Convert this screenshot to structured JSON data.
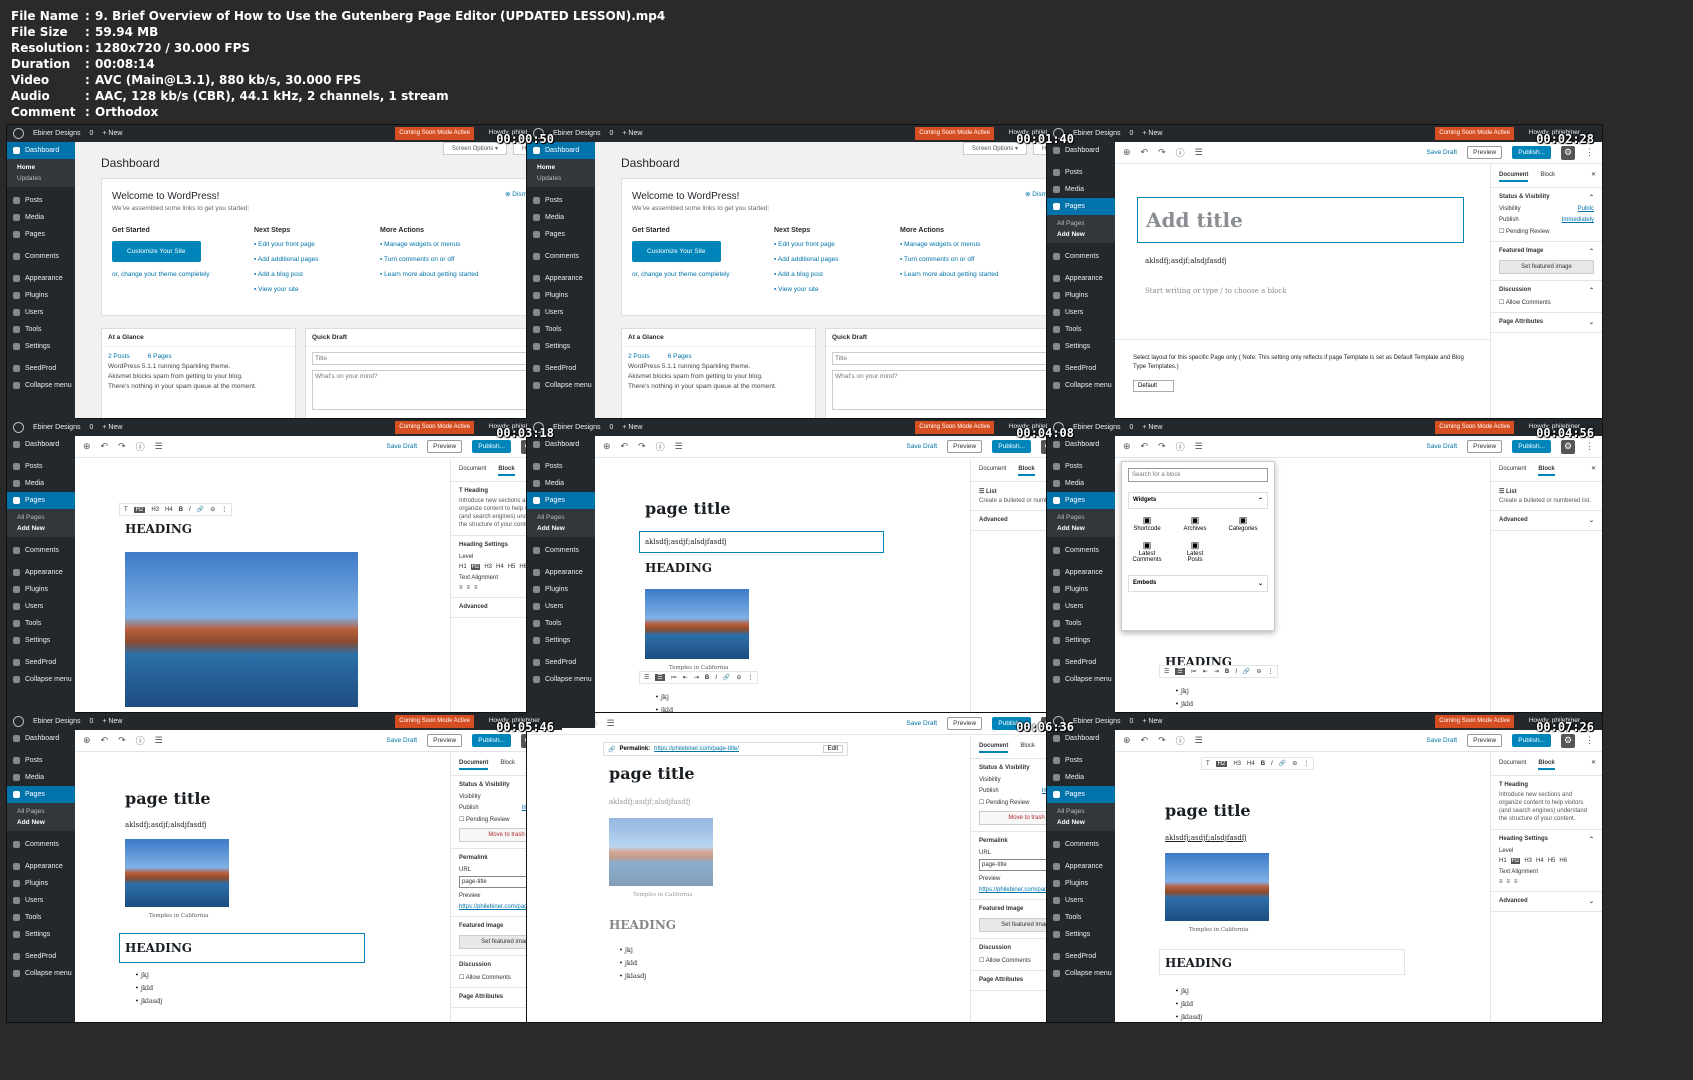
{
  "meta": [
    {
      "key": "File Name",
      "val": "9. Brief Overview of How to Use the Gutenberg Page Editor (UPDATED LESSON).mp4"
    },
    {
      "key": "File Size",
      "val": "59.94 MB"
    },
    {
      "key": "Resolution",
      "val": "1280x720 / 30.000 FPS"
    },
    {
      "key": "Duration",
      "val": "00:08:14"
    },
    {
      "key": "Video",
      "val": "AVC (Main@L3.1), 880 kb/s, 30.000 FPS"
    },
    {
      "key": "Audio",
      "val": "AAC, 128 kb/s (CBR), 44.1 kHz, 2 channels, 1 stream"
    },
    {
      "key": "Comment",
      "val": "Orthodox"
    }
  ],
  "timestamps": [
    "00:00:50",
    "00:01:40",
    "00:02:28",
    "00:03:18",
    "00:04:08",
    "00:04:56",
    "00:05:46",
    "00:06:36",
    "00:07:26"
  ],
  "admin": {
    "site": "Ebiner Designs",
    "comments": "0",
    "new": "New",
    "coming_soon": "Coming Soon Mode Active",
    "howdy": "Howdy, philebiner"
  },
  "sidebar": {
    "dashboard": "Dashboard",
    "home": "Home",
    "updates": "Updates",
    "posts": "Posts",
    "media": "Media",
    "pages": "Pages",
    "all_pages": "All Pages",
    "add_new": "Add New",
    "comments": "Comments",
    "appearance": "Appearance",
    "plugins": "Plugins",
    "users": "Users",
    "tools": "Tools",
    "settings": "Settings",
    "seedprod": "SeedProd",
    "collapse": "Collapse menu"
  },
  "dash": {
    "title": "Dashboard",
    "screen_options": "Screen Options ▾",
    "help": "Help ▾",
    "welcome": "Welcome to WordPress!",
    "assembled": "We've assembled some links to get you started:",
    "dismiss": "Dismiss",
    "get_started": "Get Started",
    "customize": "Customize Your Site",
    "or_change": "or, change your theme completely",
    "next_steps": "Next Steps",
    "ns": [
      "Edit your front page",
      "Add additional pages",
      "Add a blog post",
      "View your site"
    ],
    "more_actions": "More Actions",
    "ma": [
      "Manage widgets or menus",
      "Turn comments on or off",
      "Learn more about getting started"
    ],
    "glance": "At a Glance",
    "posts_count": "2 Posts",
    "pages_count": "6 Pages",
    "running": "WordPress 5.1.1 running Sparkling theme.",
    "akismet": "Akismet blocks spam from getting to your blog.",
    "spam": "There's nothing in your spam queue at the moment.",
    "quick_draft": "Quick Draft",
    "qd_title": "Title",
    "qd_mind": "What's on your mind?"
  },
  "editor": {
    "save_draft": "Save Draft",
    "preview": "Preview",
    "publish": "Publish...",
    "add_title": "Add title",
    "para": "aklsdfj;asdjf;alsdjfasdfj",
    "start": "Start writing or type / to choose a block",
    "layout_note": "Select layout for this specific Page only ( Note: This setting only reflects if page Template is set as Default Template and Blog Type Templates.)",
    "default": "Default",
    "page_title": "page title",
    "heading": "HEADING",
    "caption": "Temples in California",
    "list": [
      "jkj",
      "jkld",
      "jklasdj"
    ],
    "permalink": "Permalink:",
    "permalink_url": "https://philebiner.com/page-title/",
    "edit": "Edit",
    "search_block": "Search for a block",
    "widgets": "Widgets",
    "embeds": "Embeds",
    "widget_items": [
      "Shortcode",
      "Archives",
      "Categories",
      "Latest Comments",
      "Latest Posts"
    ]
  },
  "panel": {
    "document": "Document",
    "block": "Block",
    "status": "Status & Visibility",
    "visibility": "Visibility",
    "public": "Public",
    "publish": "Publish",
    "immediately": "Immediately",
    "pending": "Pending Review",
    "trash": "Move to trash",
    "permalink": "Permalink",
    "url": "URL",
    "url_val": "page-title",
    "preview": "Preview",
    "featured": "Featured Image",
    "set_featured": "Set featured image",
    "discussion": "Discussion",
    "allow": "Allow Comments",
    "attributes": "Page Attributes",
    "heading_block": "Heading",
    "heading_desc": "Introduce new sections and organize content to help visitors (and search engines) understand the structure of your content.",
    "heading_settings": "Heading Settings",
    "level": "Level",
    "text_align": "Text Alignment",
    "advanced": "Advanced",
    "list_block": "List",
    "list_desc": "Create a bulleted or numbered list."
  }
}
